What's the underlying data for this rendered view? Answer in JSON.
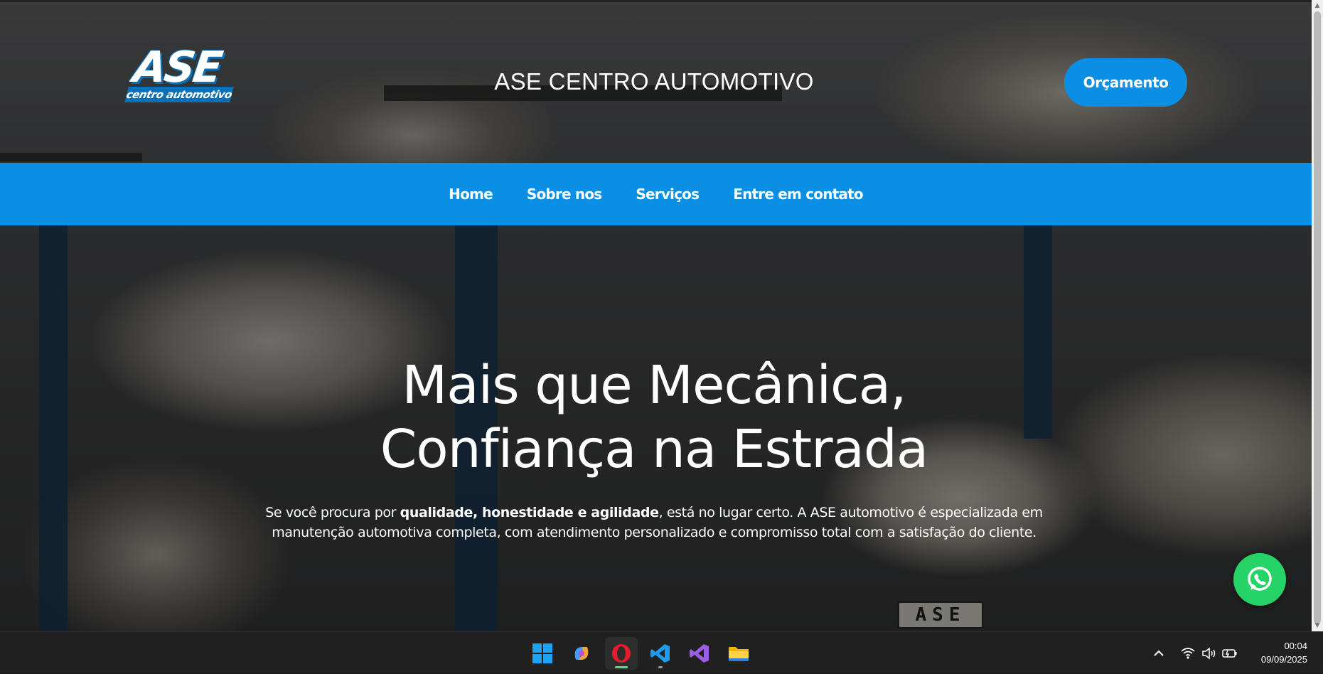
{
  "header": {
    "logo_main": "ASE",
    "logo_sub": "centro automotivo",
    "site_title": "ASE CENTRO AUTOMOTIVO",
    "cta_label": "Orçamento"
  },
  "nav": {
    "items": [
      {
        "label": "Home"
      },
      {
        "label": "Sobre nos"
      },
      {
        "label": "Serviços"
      },
      {
        "label": "Entre em contato"
      }
    ]
  },
  "hero": {
    "title_line1": "Mais que Mecânica,",
    "title_line2": "Confiança na Estrada",
    "text_before": "Se você procura por ",
    "text_bold": "qualidade, honestidade e agilidade",
    "text_after": ", está no lugar certo. A ASE automotivo é especializada em manutenção automotiva completa, com atendimento personalizado e compromisso total com a satisfação do cliente.",
    "plate_text": "ASE"
  },
  "floating": {
    "whatsapp_icon": "whatsapp-icon"
  },
  "taskbar": {
    "apps": [
      "windows-start-icon",
      "copilot-icon",
      "opera-icon",
      "vscode-icon",
      "visual-studio-icon",
      "file-explorer-icon"
    ],
    "tray_icons": [
      "chevron-up-icon",
      "wifi-icon",
      "volume-icon",
      "battery-icon"
    ],
    "time": "00:04",
    "date": "09/09/2025"
  },
  "colors": {
    "brand_blue": "#0b8fe4",
    "logo_blue": "#0b6fb5",
    "whatsapp_green": "#25d366"
  }
}
